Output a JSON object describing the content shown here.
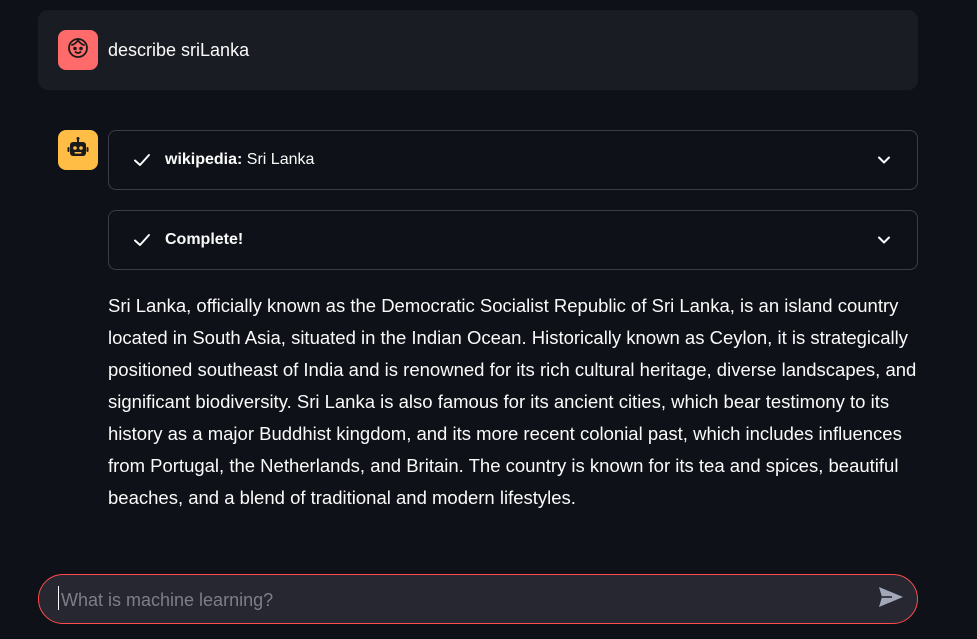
{
  "user_message": {
    "avatar_icon": "face-icon",
    "avatar_color": "#ff6b6b",
    "text": "describe sriLanka"
  },
  "assistant_message": {
    "avatar_icon": "robot-icon",
    "avatar_color": "#ffbd45",
    "expanders": [
      {
        "status_icon": "check-icon",
        "label_bold": "wikipedia:",
        "label_rest": " Sri Lanka"
      },
      {
        "status_icon": "check-icon",
        "label_bold": "Complete!",
        "label_rest": ""
      }
    ],
    "answer": "Sri Lanka, officially known as the Democratic Socialist Republic of Sri Lanka, is an island country located in South Asia, situated in the Indian Ocean. Historically known as Ceylon, it is strategically positioned southeast of India and is renowned for its rich cultural heritage, diverse landscapes, and significant biodiversity. Sri Lanka is also famous for its ancient cities, which bear testimony to its history as a major Buddhist kingdom, and its more recent colonial past, which includes influences from Portugal, the Netherlands, and Britain. The country is known for its tea and spices, beautiful beaches, and a blend of traditional and modern lifestyles."
  },
  "chat_input": {
    "value": "",
    "placeholder": "What is machine learning?",
    "send_icon": "send-icon",
    "border_color": "#ff4b4b"
  },
  "colors": {
    "background": "#0e1117",
    "user_bubble": "#1a1c24",
    "text": "#fafafa"
  }
}
